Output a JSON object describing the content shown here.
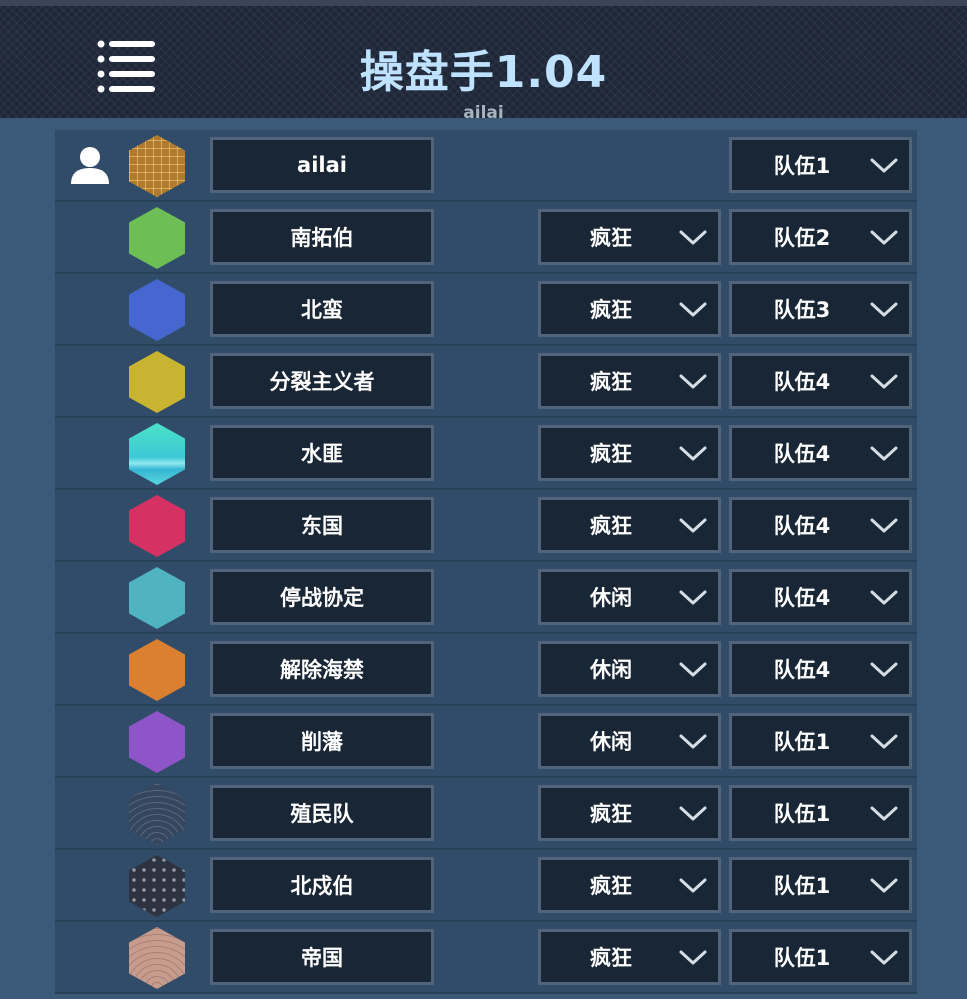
{
  "header": {
    "title": "操盘手1.04",
    "subtitle": "ailai",
    "menu_icon": "menu-list-icon"
  },
  "rows": [
    {
      "name": "ailai",
      "mode": "",
      "team": "队伍1",
      "color": "#b07b2c",
      "pattern": "grid",
      "is_user": true
    },
    {
      "name": "南拓伯",
      "mode": "疯狂",
      "team": "队伍2",
      "color": "#6dbf55",
      "pattern": "solid"
    },
    {
      "name": "北蛮",
      "mode": "疯狂",
      "team": "队伍3",
      "color": "#4567cf",
      "pattern": "solid"
    },
    {
      "name": "分裂主义者",
      "mode": "疯狂",
      "team": "队伍4",
      "color": "#c9b431",
      "pattern": "solid"
    },
    {
      "name": "水匪",
      "mode": "疯狂",
      "team": "队伍4",
      "color": "#3fd8c4",
      "pattern": "water"
    },
    {
      "name": "东国",
      "mode": "疯狂",
      "team": "队伍4",
      "color": "#d53263",
      "pattern": "solid"
    },
    {
      "name": "停战协定",
      "mode": "休闲",
      "team": "队伍4",
      "color": "#4fb3c0",
      "pattern": "solid"
    },
    {
      "name": "解除海禁",
      "mode": "休闲",
      "team": "队伍4",
      "color": "#db8030",
      "pattern": "solid"
    },
    {
      "name": "削藩",
      "mode": "休闲",
      "team": "队伍1",
      "color": "#8e55c8",
      "pattern": "solid"
    },
    {
      "name": "殖民队",
      "mode": "疯狂",
      "team": "队伍1",
      "color": "#36465d",
      "pattern": "waves"
    },
    {
      "name": "北戍伯",
      "mode": "疯狂",
      "team": "队伍1",
      "color": "#2d3340",
      "pattern": "dots"
    },
    {
      "name": "帝国",
      "mode": "疯狂",
      "team": "队伍1",
      "color": "#c59c8e",
      "pattern": "scales"
    }
  ],
  "icons": {
    "user": "user-icon",
    "chevron": "chevron-down-icon"
  }
}
